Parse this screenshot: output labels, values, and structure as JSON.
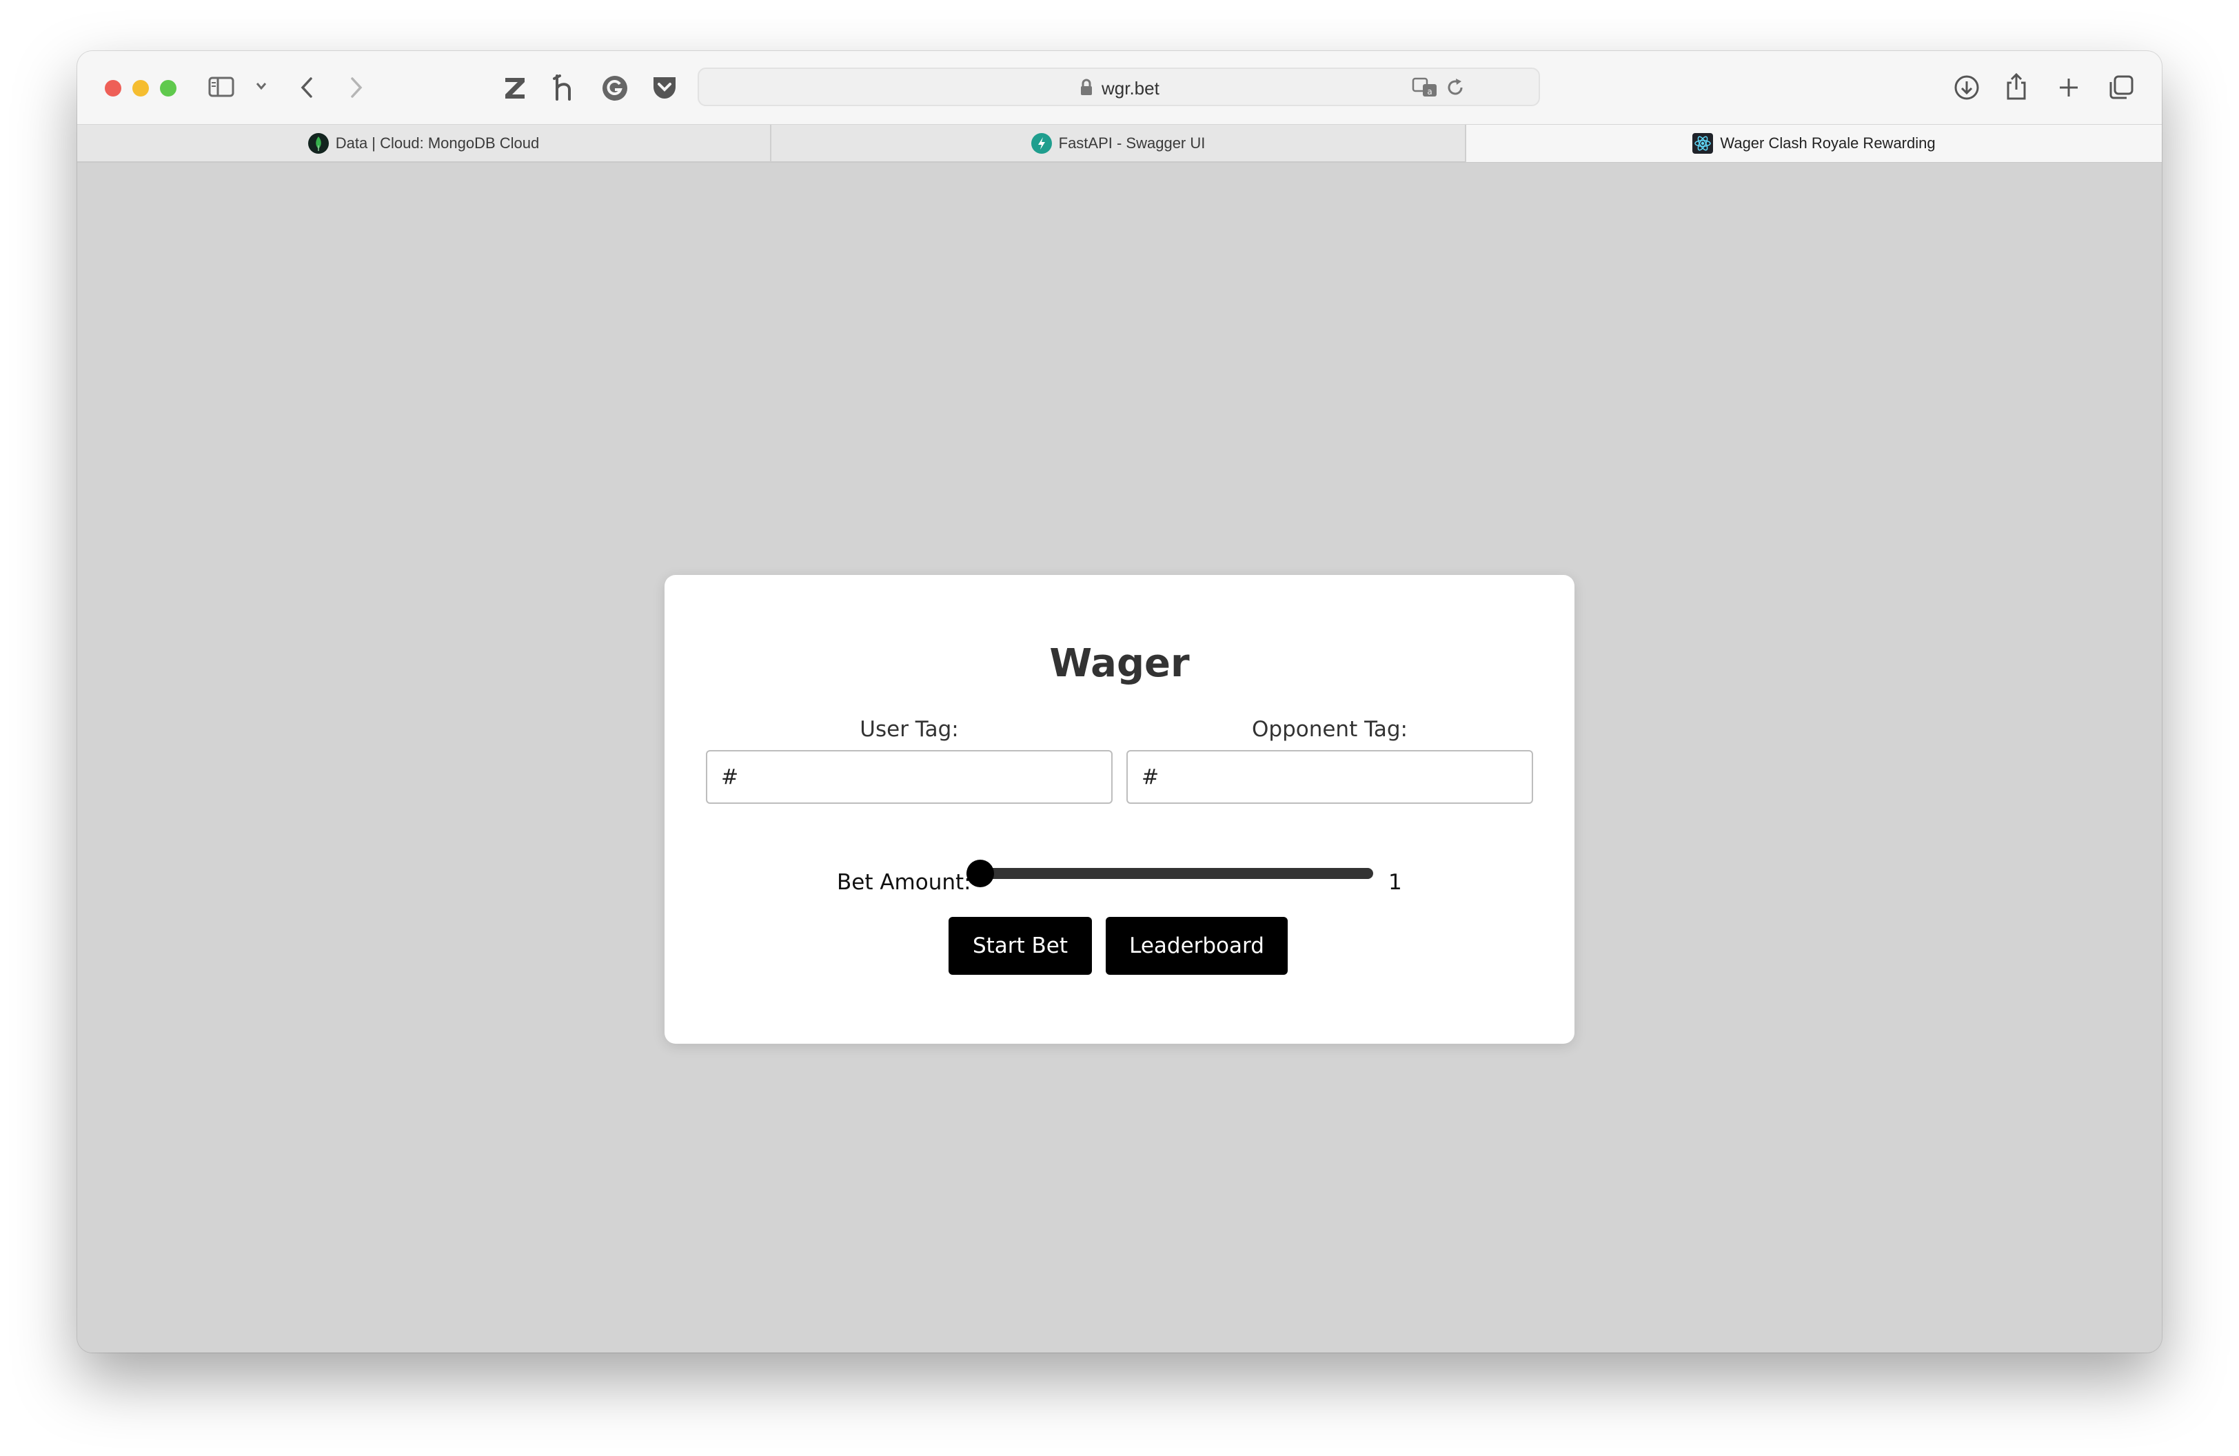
{
  "browser": {
    "address": {
      "url": "wgr.bet"
    },
    "tabs": [
      {
        "label": "Data | Cloud: MongoDB Cloud",
        "active": false,
        "icon": "mongodb-leaf-icon"
      },
      {
        "label": "FastAPI - Swagger UI",
        "active": false,
        "icon": "fastapi-bolt-icon"
      },
      {
        "label": "Wager Clash Royale Rewarding",
        "active": true,
        "icon": "react-atom-icon"
      }
    ],
    "colors": {
      "close": "#ee5f57",
      "minimize": "#f5bd30",
      "maximize": "#5fc94d"
    }
  },
  "page": {
    "title": "Wager",
    "user_tag": {
      "label": "User Tag:",
      "value": "#"
    },
    "opponent_tag": {
      "label": "Opponent Tag:",
      "value": "#"
    },
    "bet": {
      "label": "Bet Amount:",
      "value": "1",
      "fraction": 0
    },
    "buttons": {
      "start": "Start Bet",
      "leaderboard": "Leaderboard"
    },
    "colors": {
      "background": "#d3d3d3",
      "card": "#ffffff",
      "button": "#000000"
    }
  }
}
